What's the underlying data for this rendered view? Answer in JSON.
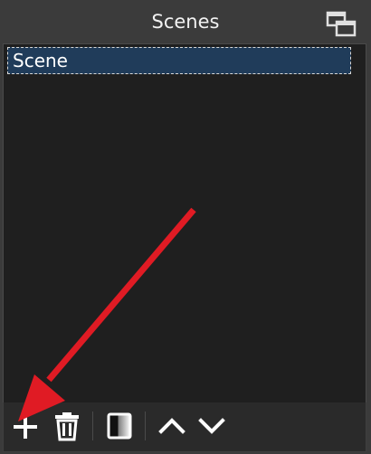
{
  "dock": {
    "title": "Scenes",
    "float_icon": "float-dock-icon"
  },
  "scenes": {
    "items": [
      {
        "label": "Scene",
        "selected": true
      }
    ]
  },
  "toolbar": {
    "buttons": [
      {
        "icon": "add-icon"
      },
      {
        "icon": "trash-icon"
      },
      {
        "icon": "filter-icon"
      },
      {
        "icon": "chevron-up-icon"
      },
      {
        "icon": "chevron-down-icon"
      }
    ]
  },
  "colors": {
    "background": "#3b3b3b",
    "list_background": "#1f1f1f",
    "selection": "#203c5a",
    "annotation_arrow": "#e01b24"
  }
}
